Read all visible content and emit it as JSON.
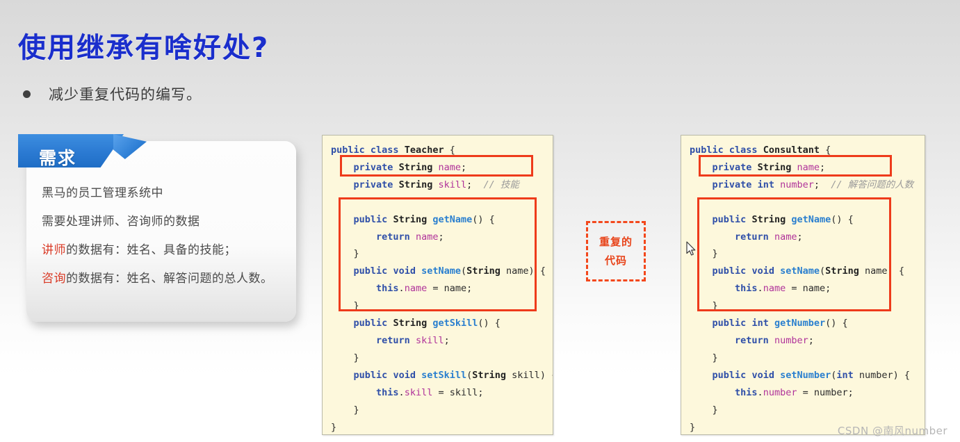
{
  "slide": {
    "title": "使用继承有啥好处?",
    "bullet": "减少重复代码的编写。",
    "watermark": "CSDN @南风number"
  },
  "requirement_card": {
    "ribbon_label": "需求",
    "lines": [
      {
        "plain": "黑马的员工管理系统中"
      },
      {
        "plain": "需要处理讲师、咨询师的数据"
      },
      {
        "highlight": "讲师",
        "plain": "的数据有：姓名、具备的技能；"
      },
      {
        "highlight": "咨询",
        "plain": "的数据有：姓名、解答问题的总人数。"
      }
    ]
  },
  "duplicate_callout": {
    "line1": "重复的",
    "line2": "代码"
  },
  "code_left": {
    "lines": [
      [
        {
          "t": "public",
          "c": "kw"
        },
        {
          "t": " ",
          "c": "pln"
        },
        {
          "t": "class",
          "c": "kw"
        },
        {
          "t": " ",
          "c": "pln"
        },
        {
          "t": "Teacher",
          "c": "typ"
        },
        {
          "t": " {",
          "c": "pln"
        }
      ],
      [
        {
          "t": "    ",
          "c": "pln"
        },
        {
          "t": "private",
          "c": "kw"
        },
        {
          "t": " ",
          "c": "pln"
        },
        {
          "t": "String",
          "c": "typ"
        },
        {
          "t": " ",
          "c": "pln"
        },
        {
          "t": "name",
          "c": "fld"
        },
        {
          "t": ";",
          "c": "pln"
        }
      ],
      [
        {
          "t": "    ",
          "c": "pln"
        },
        {
          "t": "private",
          "c": "kw"
        },
        {
          "t": " ",
          "c": "pln"
        },
        {
          "t": "String",
          "c": "typ"
        },
        {
          "t": " ",
          "c": "pln"
        },
        {
          "t": "skill",
          "c": "fld"
        },
        {
          "t": ";  ",
          "c": "pln"
        },
        {
          "t": "// 技能",
          "c": "cmt"
        }
      ],
      [
        {
          "t": " ",
          "c": "pln"
        }
      ],
      [
        {
          "t": "    ",
          "c": "pln"
        },
        {
          "t": "public",
          "c": "kw"
        },
        {
          "t": " ",
          "c": "pln"
        },
        {
          "t": "String",
          "c": "typ"
        },
        {
          "t": " ",
          "c": "pln"
        },
        {
          "t": "getName",
          "c": "mth"
        },
        {
          "t": "() {",
          "c": "pln"
        }
      ],
      [
        {
          "t": "        ",
          "c": "pln"
        },
        {
          "t": "return",
          "c": "kw"
        },
        {
          "t": " ",
          "c": "pln"
        },
        {
          "t": "name",
          "c": "fld"
        },
        {
          "t": ";",
          "c": "pln"
        }
      ],
      [
        {
          "t": "    }",
          "c": "pln"
        }
      ],
      [
        {
          "t": "    ",
          "c": "pln"
        },
        {
          "t": "public",
          "c": "kw"
        },
        {
          "t": " ",
          "c": "pln"
        },
        {
          "t": "void",
          "c": "kw"
        },
        {
          "t": " ",
          "c": "pln"
        },
        {
          "t": "setName",
          "c": "mth"
        },
        {
          "t": "(",
          "c": "pln"
        },
        {
          "t": "String",
          "c": "typ"
        },
        {
          "t": " name) {",
          "c": "pln"
        }
      ],
      [
        {
          "t": "        ",
          "c": "pln"
        },
        {
          "t": "this",
          "c": "kw"
        },
        {
          "t": ".",
          "c": "pln"
        },
        {
          "t": "name",
          "c": "fld"
        },
        {
          "t": " = name;",
          "c": "pln"
        }
      ],
      [
        {
          "t": "    }",
          "c": "pln"
        }
      ],
      [
        {
          "t": "    ",
          "c": "pln"
        },
        {
          "t": "public",
          "c": "kw"
        },
        {
          "t": " ",
          "c": "pln"
        },
        {
          "t": "String",
          "c": "typ"
        },
        {
          "t": " ",
          "c": "pln"
        },
        {
          "t": "getSkill",
          "c": "mth"
        },
        {
          "t": "() {",
          "c": "pln"
        }
      ],
      [
        {
          "t": "        ",
          "c": "pln"
        },
        {
          "t": "return",
          "c": "kw"
        },
        {
          "t": " ",
          "c": "pln"
        },
        {
          "t": "skill",
          "c": "fld"
        },
        {
          "t": ";",
          "c": "pln"
        }
      ],
      [
        {
          "t": "    }",
          "c": "pln"
        }
      ],
      [
        {
          "t": "    ",
          "c": "pln"
        },
        {
          "t": "public",
          "c": "kw"
        },
        {
          "t": " ",
          "c": "pln"
        },
        {
          "t": "void",
          "c": "kw"
        },
        {
          "t": " ",
          "c": "pln"
        },
        {
          "t": "setSkill",
          "c": "mth"
        },
        {
          "t": "(",
          "c": "pln"
        },
        {
          "t": "String",
          "c": "typ"
        },
        {
          "t": " skill) {",
          "c": "pln"
        }
      ],
      [
        {
          "t": "        ",
          "c": "pln"
        },
        {
          "t": "this",
          "c": "kw"
        },
        {
          "t": ".",
          "c": "pln"
        },
        {
          "t": "skill",
          "c": "fld"
        },
        {
          "t": " = skill;",
          "c": "pln"
        }
      ],
      [
        {
          "t": "    }",
          "c": "pln"
        }
      ],
      [
        {
          "t": "}",
          "c": "pln"
        }
      ]
    ]
  },
  "code_right": {
    "lines": [
      [
        {
          "t": "public",
          "c": "kw"
        },
        {
          "t": " ",
          "c": "pln"
        },
        {
          "t": "class",
          "c": "kw"
        },
        {
          "t": " ",
          "c": "pln"
        },
        {
          "t": "Consultant",
          "c": "typ"
        },
        {
          "t": " {",
          "c": "pln"
        }
      ],
      [
        {
          "t": "    ",
          "c": "pln"
        },
        {
          "t": "private",
          "c": "kw"
        },
        {
          "t": " ",
          "c": "pln"
        },
        {
          "t": "String",
          "c": "typ"
        },
        {
          "t": " ",
          "c": "pln"
        },
        {
          "t": "name",
          "c": "fld"
        },
        {
          "t": ";",
          "c": "pln"
        }
      ],
      [
        {
          "t": "    ",
          "c": "pln"
        },
        {
          "t": "private",
          "c": "kw"
        },
        {
          "t": " ",
          "c": "pln"
        },
        {
          "t": "int",
          "c": "kw"
        },
        {
          "t": " ",
          "c": "pln"
        },
        {
          "t": "number",
          "c": "fld"
        },
        {
          "t": ";  ",
          "c": "pln"
        },
        {
          "t": "// 解答问题的人数",
          "c": "cmt"
        }
      ],
      [
        {
          "t": " ",
          "c": "pln"
        }
      ],
      [
        {
          "t": "    ",
          "c": "pln"
        },
        {
          "t": "public",
          "c": "kw"
        },
        {
          "t": " ",
          "c": "pln"
        },
        {
          "t": "String",
          "c": "typ"
        },
        {
          "t": " ",
          "c": "pln"
        },
        {
          "t": "getName",
          "c": "mth"
        },
        {
          "t": "() {",
          "c": "pln"
        }
      ],
      [
        {
          "t": "        ",
          "c": "pln"
        },
        {
          "t": "return",
          "c": "kw"
        },
        {
          "t": " ",
          "c": "pln"
        },
        {
          "t": "name",
          "c": "fld"
        },
        {
          "t": ";",
          "c": "pln"
        }
      ],
      [
        {
          "t": "    }",
          "c": "pln"
        }
      ],
      [
        {
          "t": "    ",
          "c": "pln"
        },
        {
          "t": "public",
          "c": "kw"
        },
        {
          "t": " ",
          "c": "pln"
        },
        {
          "t": "void",
          "c": "kw"
        },
        {
          "t": " ",
          "c": "pln"
        },
        {
          "t": "setName",
          "c": "mth"
        },
        {
          "t": "(",
          "c": "pln"
        },
        {
          "t": "String",
          "c": "typ"
        },
        {
          "t": " name) {",
          "c": "pln"
        }
      ],
      [
        {
          "t": "        ",
          "c": "pln"
        },
        {
          "t": "this",
          "c": "kw"
        },
        {
          "t": ".",
          "c": "pln"
        },
        {
          "t": "name",
          "c": "fld"
        },
        {
          "t": " = name;",
          "c": "pln"
        }
      ],
      [
        {
          "t": "    }",
          "c": "pln"
        }
      ],
      [
        {
          "t": "    ",
          "c": "pln"
        },
        {
          "t": "public",
          "c": "kw"
        },
        {
          "t": " ",
          "c": "pln"
        },
        {
          "t": "int",
          "c": "kw"
        },
        {
          "t": " ",
          "c": "pln"
        },
        {
          "t": "getNumber",
          "c": "mth"
        },
        {
          "t": "() {",
          "c": "pln"
        }
      ],
      [
        {
          "t": "        ",
          "c": "pln"
        },
        {
          "t": "return",
          "c": "kw"
        },
        {
          "t": " ",
          "c": "pln"
        },
        {
          "t": "number",
          "c": "fld"
        },
        {
          "t": ";",
          "c": "pln"
        }
      ],
      [
        {
          "t": "    }",
          "c": "pln"
        }
      ],
      [
        {
          "t": "    ",
          "c": "pln"
        },
        {
          "t": "public",
          "c": "kw"
        },
        {
          "t": " ",
          "c": "pln"
        },
        {
          "t": "void",
          "c": "kw"
        },
        {
          "t": " ",
          "c": "pln"
        },
        {
          "t": "setNumber",
          "c": "mth"
        },
        {
          "t": "(",
          "c": "pln"
        },
        {
          "t": "int",
          "c": "kw"
        },
        {
          "t": " number) {",
          "c": "pln"
        }
      ],
      [
        {
          "t": "        ",
          "c": "pln"
        },
        {
          "t": "this",
          "c": "kw"
        },
        {
          "t": ".",
          "c": "pln"
        },
        {
          "t": "number",
          "c": "fld"
        },
        {
          "t": " = number;",
          "c": "pln"
        }
      ],
      [
        {
          "t": "    }",
          "c": "pln"
        }
      ],
      [
        {
          "t": "}",
          "c": "pln"
        }
      ]
    ]
  },
  "colors": {
    "title": "#1a2ecc",
    "ribbon": "#2b7ad2",
    "highlight_box": "#ee3b1b",
    "callout": "#e8441a",
    "code_bg": "#fdf8dc",
    "req_highlight": "#d93a26"
  }
}
